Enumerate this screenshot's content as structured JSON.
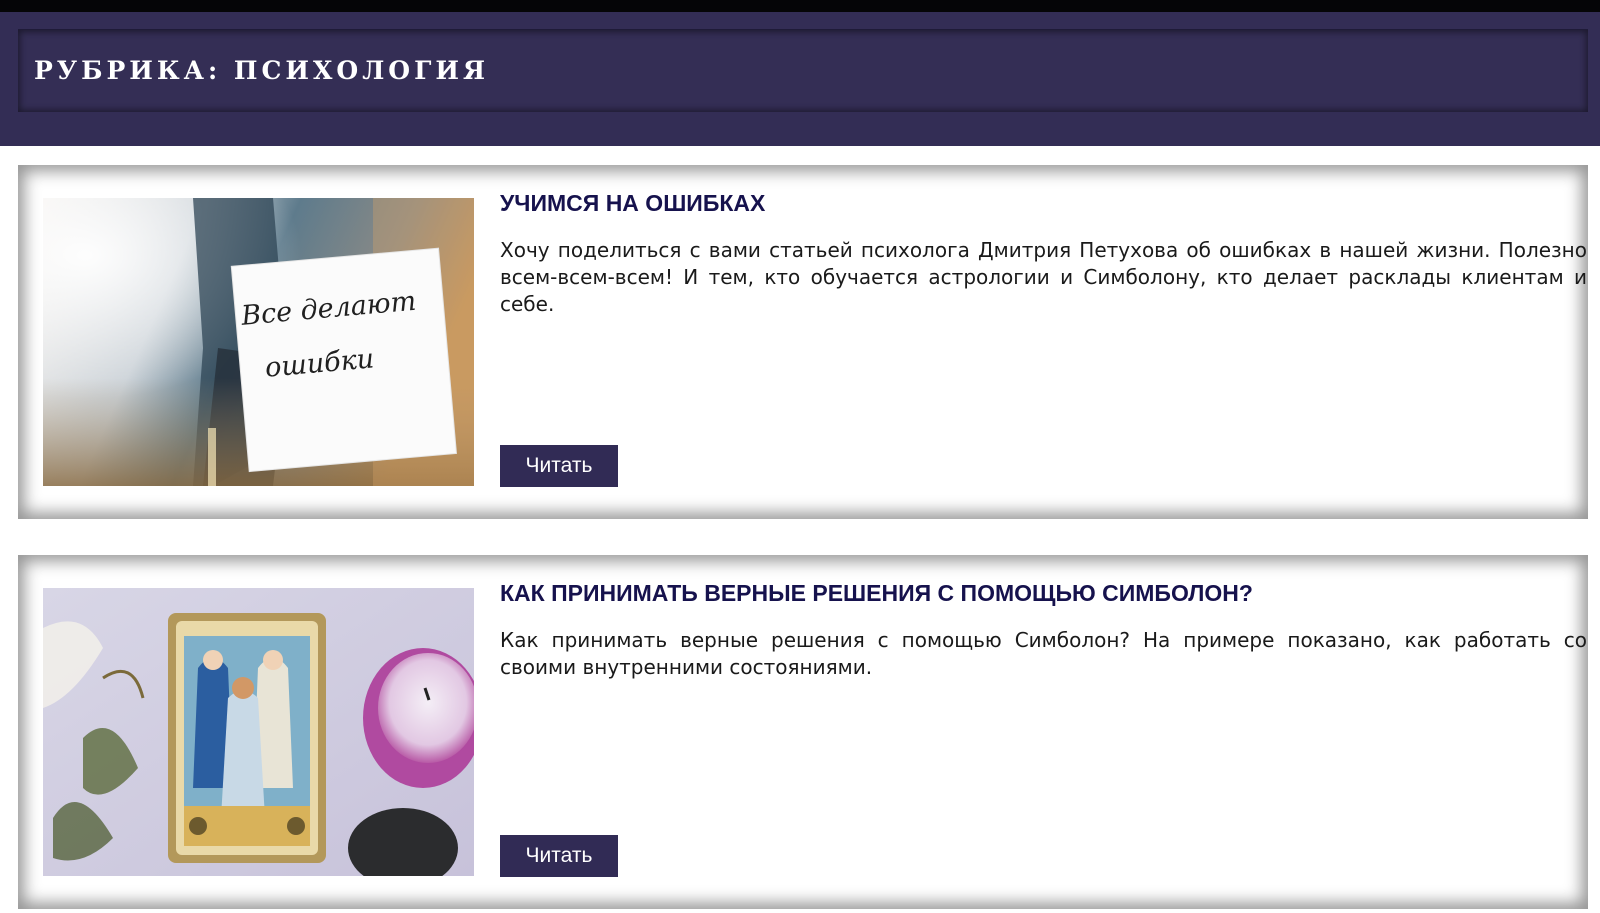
{
  "header": {
    "title": "РУБРИКА: ПСИХОЛОГИЯ"
  },
  "articles": [
    {
      "title": "УЧИМСЯ НА ОШИБКАХ",
      "excerpt": "Хочу поделиться с вами статьей психолога Дмитрия Петухова об ошибках в нашей жизни. Полезно всем-всем-всем! И тем, кто обучается астрологии и Симболону, кто делает расклады клиентам и себе.",
      "image_note": "Все делают ошибки",
      "read_label": "Читать"
    },
    {
      "title": "КАК ПРИНИМАТЬ ВЕРНЫЕ РЕШЕНИЯ С ПОМОЩЬЮ СИМБОЛОН?",
      "excerpt": "Как принимать верные решения с помощью Симболон? На примере показано, как работать со своими внутренними состояниями.",
      "read_label": "Читать"
    }
  ],
  "colors": {
    "header_bg": "#332d55",
    "title_color": "#16124d",
    "button_bg": "#312b55"
  }
}
